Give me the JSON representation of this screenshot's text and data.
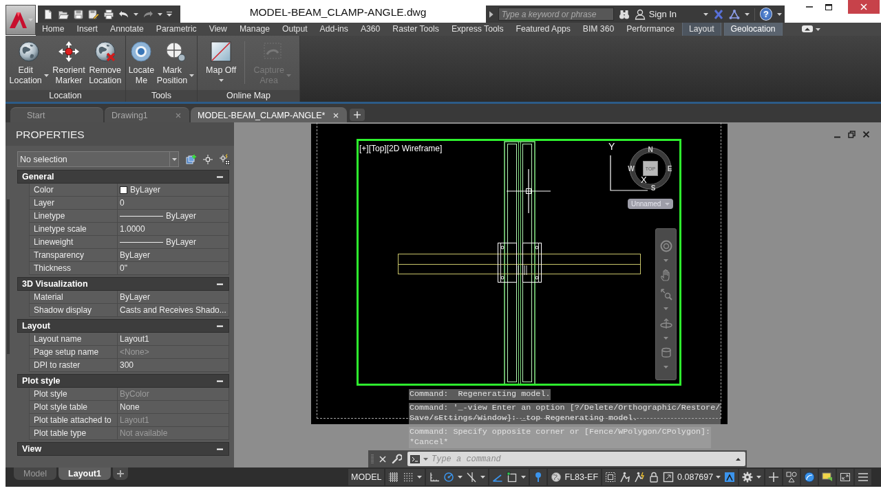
{
  "window": {
    "title": "MODEL-BEAM_CLAMP-ANGLE.dwg"
  },
  "search": {
    "placeholder": "Type a keyword or phrase"
  },
  "account": {
    "label": "Sign In"
  },
  "help": {
    "label": "?"
  },
  "ribbon_tabs": [
    {
      "label": "Home",
      "selected": false,
      "contextual": false
    },
    {
      "label": "Insert",
      "selected": false,
      "contextual": false
    },
    {
      "label": "Annotate",
      "selected": false,
      "contextual": false
    },
    {
      "label": "Parametric",
      "selected": false,
      "contextual": false
    },
    {
      "label": "View",
      "selected": false,
      "contextual": false
    },
    {
      "label": "Manage",
      "selected": false,
      "contextual": false
    },
    {
      "label": "Output",
      "selected": false,
      "contextual": false
    },
    {
      "label": "Add-ins",
      "selected": false,
      "contextual": false
    },
    {
      "label": "A360",
      "selected": false,
      "contextual": false
    },
    {
      "label": "Raster Tools",
      "selected": false,
      "contextual": false
    },
    {
      "label": "Express Tools",
      "selected": false,
      "contextual": false
    },
    {
      "label": "Featured Apps",
      "selected": false,
      "contextual": false
    },
    {
      "label": "BIM 360",
      "selected": false,
      "contextual": false
    },
    {
      "label": "Performance",
      "selected": false,
      "contextual": false
    },
    {
      "label": "Layout",
      "selected": false,
      "contextual": true
    },
    {
      "label": "Geolocation",
      "selected": true,
      "contextual": true
    }
  ],
  "ribbon_panels": [
    {
      "title": "Location",
      "buttons": [
        {
          "kind": "edit-location",
          "lines": [
            "Edit",
            "Location"
          ],
          "menu": true,
          "disabled": false
        },
        {
          "kind": "reorient-marker",
          "lines": [
            "Reorient",
            "Marker"
          ],
          "menu": false,
          "disabled": false
        },
        {
          "kind": "remove-location",
          "lines": [
            "Remove",
            "Location"
          ],
          "menu": false,
          "disabled": false
        }
      ]
    },
    {
      "title": "Tools",
      "buttons": [
        {
          "kind": "locate-me",
          "lines": [
            "Locate",
            "Me"
          ],
          "menu": false,
          "disabled": false
        },
        {
          "kind": "mark-position",
          "lines": [
            "Mark",
            "Position"
          ],
          "menu": true,
          "disabled": false
        }
      ]
    },
    {
      "title": "Online Map",
      "buttons": [
        {
          "kind": "map-off",
          "lines": [
            "Map Off"
          ],
          "menu": true,
          "disabled": false
        },
        {
          "kind": "capture-area",
          "lines": [
            "Capture",
            "Area"
          ],
          "menu": true,
          "disabled": true
        }
      ]
    }
  ],
  "document_tabs": [
    {
      "label": "Start",
      "selected": false,
      "closable": false
    },
    {
      "label": "Drawing1",
      "selected": false,
      "closable": true
    },
    {
      "label": "MODEL-BEAM_CLAMP-ANGLE*",
      "selected": true,
      "closable": true
    }
  ],
  "properties": {
    "title": "PROPERTIES",
    "selection": "No selection",
    "sections": [
      {
        "title": "General",
        "expanded": true,
        "rows": [
          {
            "label": "Color",
            "value": "ByLayer",
            "kind": "color",
            "disabled": false
          },
          {
            "label": "Layer",
            "value": "0",
            "kind": "text",
            "disabled": false
          },
          {
            "label": "Linetype",
            "value": "ByLayer",
            "kind": "linetype",
            "disabled": false
          },
          {
            "label": "Linetype scale",
            "value": "1.0000",
            "kind": "text",
            "disabled": false
          },
          {
            "label": "Lineweight",
            "value": "ByLayer",
            "kind": "linetype",
            "disabled": false
          },
          {
            "label": "Transparency",
            "value": "ByLayer",
            "kind": "text",
            "disabled": false
          },
          {
            "label": "Thickness",
            "value": "0\"",
            "kind": "text",
            "disabled": false
          }
        ]
      },
      {
        "title": "3D Visualization",
        "expanded": true,
        "rows": [
          {
            "label": "Material",
            "value": "ByLayer",
            "kind": "text",
            "disabled": false
          },
          {
            "label": "Shadow display",
            "value": "Casts and Receives Shado...",
            "kind": "text",
            "disabled": false
          }
        ]
      },
      {
        "title": "Layout",
        "expanded": true,
        "rows": [
          {
            "label": "Layout name",
            "value": "Layout1",
            "kind": "text",
            "disabled": false
          },
          {
            "label": "Page setup name",
            "value": "<None>",
            "kind": "text",
            "disabled": true
          },
          {
            "label": "DPI to raster",
            "value": "300",
            "kind": "text",
            "disabled": false
          }
        ]
      },
      {
        "title": "Plot style",
        "expanded": true,
        "rows": [
          {
            "label": "Plot style",
            "value": "ByColor",
            "kind": "text",
            "disabled": true
          },
          {
            "label": "Plot style table",
            "value": "None",
            "kind": "text",
            "disabled": false
          },
          {
            "label": "Plot table attached to",
            "value": "Layout1",
            "kind": "text",
            "disabled": true
          },
          {
            "label": "Plot table type",
            "value": "Not available",
            "kind": "text",
            "disabled": true
          }
        ]
      },
      {
        "title": "View",
        "expanded": true
      }
    ]
  },
  "viewport": {
    "label": "[+][Top][2D Wireframe]",
    "ucs": {
      "y_label": "Y",
      "x_label": "X"
    },
    "viewcube": {
      "north": "N",
      "west": "W",
      "east": "E",
      "south": "S",
      "face": "TOP"
    },
    "view_menu": "Unnamed"
  },
  "command_history": [
    {
      "lines": [
        "Command:  Regenerating model."
      ]
    },
    {
      "lines": [
        "Command: '_-view Enter an option [?/Delete/Orthographic/Restore/",
        "Save/sEttings/Window]: _top Regenerating model."
      ]
    },
    {
      "lines": [
        "Command: Specify opposite corner or [Fence/WPolygon/CPolygon]:",
        "*Cancel*"
      ]
    }
  ],
  "command_line": {
    "placeholder": "Type a command"
  },
  "layout_tabs": [
    {
      "label": "Model",
      "selected": false
    },
    {
      "label": "Layout1",
      "selected": true
    }
  ],
  "status_bar": {
    "groups": [
      [
        {
          "kind": "model",
          "label": "MODEL"
        }
      ],
      [
        {
          "kind": "grid",
          "on": false
        },
        {
          "kind": "snap",
          "on": false
        },
        {
          "kind": "menu"
        }
      ],
      [
        {
          "kind": "ortho",
          "on": false
        },
        {
          "kind": "polar",
          "on": true
        },
        {
          "kind": "menu"
        },
        {
          "kind": "isodraft",
          "on": false
        },
        {
          "kind": "menu"
        }
      ],
      [
        {
          "kind": "tracking",
          "on": true
        },
        {
          "kind": "osnap",
          "on": false
        },
        {
          "kind": "menu"
        }
      ],
      [
        {
          "kind": "geomarker",
          "on": true
        }
      ],
      [
        {
          "kind": "coordinate-system",
          "label": "FL83-EF"
        }
      ],
      [
        {
          "kind": "select-viewport"
        },
        {
          "kind": "annotation-visibility"
        },
        {
          "kind": "autoscale"
        },
        {
          "kind": "lock"
        },
        {
          "kind": "maximize-viewport"
        },
        {
          "kind": "scale",
          "label": "0.087697"
        },
        {
          "kind": "annotation-monitor",
          "on": true
        }
      ],
      [
        {
          "kind": "workspace"
        },
        {
          "kind": "menu"
        }
      ],
      [
        {
          "kind": "annotate-plus"
        }
      ],
      [
        {
          "kind": "isolate"
        }
      ],
      [
        {
          "kind": "hardware",
          "on": true
        }
      ],
      [
        {
          "kind": "clean-screen"
        }
      ],
      [
        {
          "kind": "fullscreen"
        }
      ],
      [
        {
          "kind": "customize"
        }
      ]
    ]
  }
}
